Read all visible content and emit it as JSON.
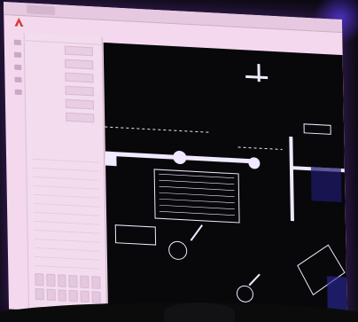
{
  "window": {
    "tab_label": ""
  },
  "toolbar": {
    "items": [
      "",
      "",
      ""
    ]
  },
  "properties_panel": {
    "header": "",
    "rows": [
      {
        "key": "",
        "value": ""
      },
      {
        "key": "",
        "value": ""
      },
      {
        "key": "",
        "value": ""
      },
      {
        "key": "",
        "value": ""
      },
      {
        "key": "",
        "value": ""
      },
      {
        "key": "",
        "value": ""
      }
    ]
  },
  "colors": {
    "screen": "#f4d9ee",
    "canvas": "#08070a",
    "lines": "#f0e9ff",
    "accent": "#d43a3a",
    "glow": "#5a3cff"
  },
  "icons": [
    "app-logo-icon",
    "tool-icon"
  ]
}
